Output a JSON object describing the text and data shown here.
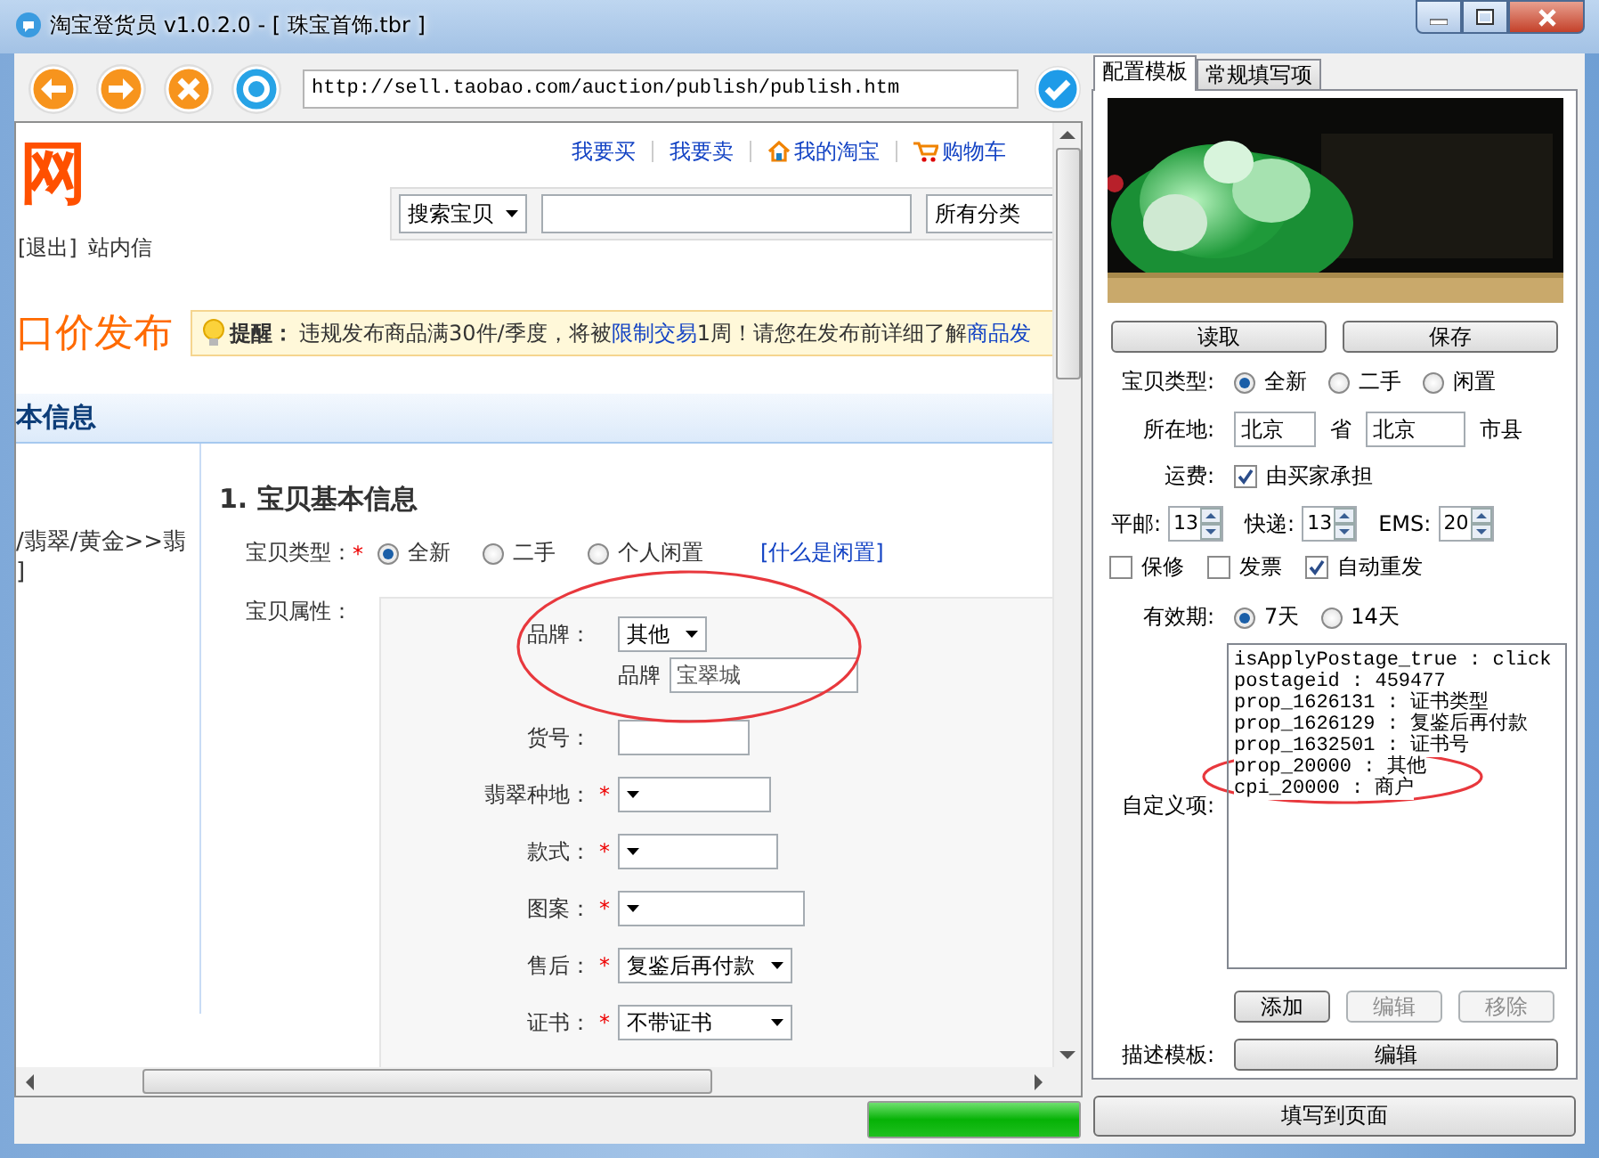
{
  "window": {
    "title": "淘宝登货员 v1.0.2.0 - [ 珠宝首饰.tbr ]"
  },
  "browser": {
    "address": "http://sell.taobao.com/auction/publish/publish.htm"
  },
  "page": {
    "logo": "网",
    "account_links": [
      "[退出]",
      "站内信"
    ],
    "top_links": [
      {
        "label": "我要买"
      },
      {
        "label": "我要卖"
      },
      {
        "label": "我的淘宝",
        "kind": "home"
      },
      {
        "label": "购物车",
        "kind": "cart"
      }
    ],
    "search": {
      "scope": "搜索宝贝",
      "category": "所有分类"
    },
    "heading": "口价发布",
    "notice": {
      "label": "提醒：",
      "parts": [
        {
          "text": "违规发布商品满30件/季度，将被",
          "link": false
        },
        {
          "text": "限制交易",
          "link": true
        },
        {
          "text": "1周！请您在发布前详细了解",
          "link": false
        },
        {
          "text": "商品发",
          "link": true
        }
      ]
    },
    "section_title": "本信息",
    "category_path": [
      "/翡翠/黄金>>翡",
      "]"
    ],
    "form_title": "1. 宝贝基本信息",
    "item_type": {
      "label": "宝贝类型：",
      "required_mark": "*",
      "options": [
        {
          "label": "全新",
          "selected": true
        },
        {
          "label": "二手",
          "selected": false
        },
        {
          "label": "个人闲置",
          "selected": false
        }
      ],
      "help_link": "[什么是闲置]"
    },
    "attributes": {
      "label": "宝贝属性：",
      "rows": [
        {
          "kind": "select",
          "label": "品牌：",
          "value": "其他"
        },
        {
          "kind": "labeled_input",
          "label": "品牌",
          "value": "宝翠城"
        },
        {
          "kind": "input",
          "label": "货号："
        },
        {
          "kind": "select",
          "label": "翡翠种地：",
          "required_mark": "*"
        },
        {
          "kind": "select",
          "label": "款式：",
          "required_mark": "*"
        },
        {
          "kind": "select",
          "label": "图案：",
          "required_mark": "*"
        },
        {
          "kind": "select",
          "label": "售后：",
          "required_mark": "*",
          "value": "复鉴后再付款"
        },
        {
          "kind": "select",
          "label": "证书：",
          "required_mark": "*",
          "value": "不带证书"
        }
      ]
    }
  },
  "progress": {
    "level": 1
  },
  "panel": {
    "tabs": [
      {
        "label": "配置模板",
        "selected": true
      },
      {
        "label": "常规填写项",
        "selected": false
      }
    ],
    "banner": {
      "kind": "picture"
    },
    "buttons": [
      "读取",
      "保存"
    ],
    "item_type": {
      "label": "宝贝类型:",
      "options": [
        {
          "label": "全新",
          "selected": true
        },
        {
          "label": "二手",
          "selected": false
        },
        {
          "label": "闲置",
          "selected": false
        }
      ]
    },
    "location": {
      "label": "所在地:",
      "province": "北京",
      "province_unit": "省",
      "city": "北京",
      "city_unit": "市县"
    },
    "shipping": {
      "label": "运费:",
      "option": {
        "label": "由买家承担",
        "checked": true
      }
    },
    "fees": [
      {
        "label": "平邮:",
        "value": "13"
      },
      {
        "label": "快递:",
        "value": "13"
      },
      {
        "label": "EMS:",
        "value": "20"
      }
    ],
    "options": [
      {
        "label": "保修",
        "checked": false
      },
      {
        "label": "发票",
        "checked": false
      },
      {
        "label": "自动重发",
        "checked": true
      }
    ],
    "validity": {
      "label": "有效期:",
      "options": [
        {
          "label": "7天",
          "selected": true
        },
        {
          "label": "14天",
          "selected": false
        }
      ]
    },
    "custom": {
      "label": "自定义项:",
      "lines": [
        "isApplyPostage_true : click",
        "postageid : 459477",
        "prop_1626131 : 证书类型",
        "prop_1626129 : 复鉴后再付款",
        "prop_1632501 : 证书号",
        "prop_20000 : 其他",
        "cpi_20000 : 商户"
      ]
    },
    "custom_buttons": [
      {
        "label": "添加",
        "disabled": false
      },
      {
        "label": "编辑",
        "disabled": true
      },
      {
        "label": "移除",
        "disabled": true
      }
    ],
    "template": {
      "label": "描述模板:",
      "button": "编辑"
    },
    "fill_button": "填写到页面"
  }
}
